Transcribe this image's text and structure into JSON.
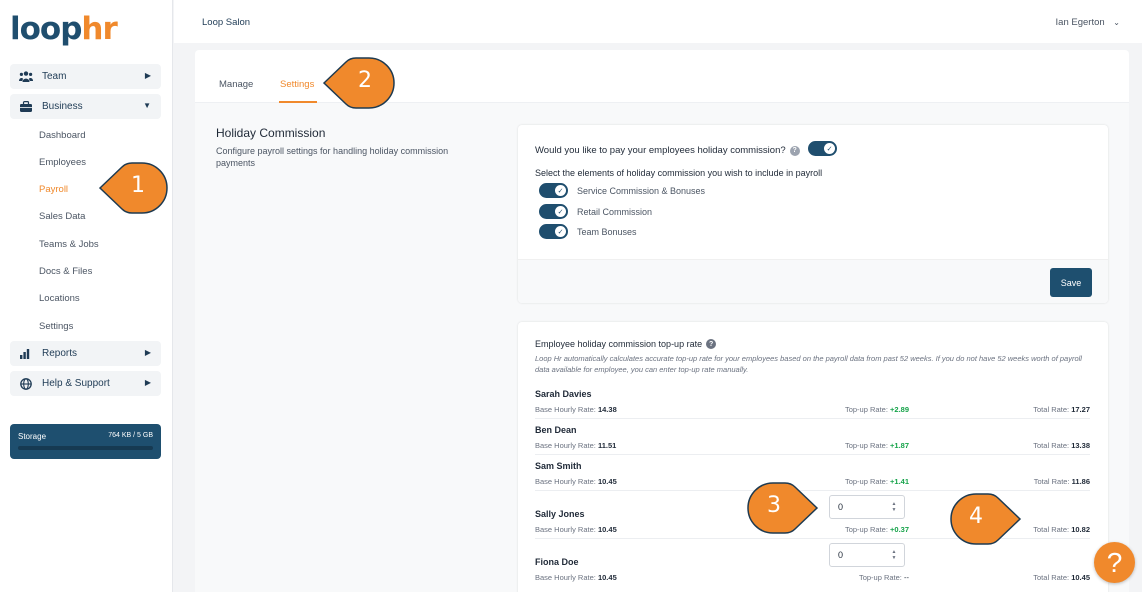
{
  "app": {
    "logo_part1": "loop",
    "logo_part2": "hr"
  },
  "header": {
    "salon": "Loop Salon",
    "user": "Ian Egerton"
  },
  "sidebar": {
    "groups": {
      "team": {
        "label": "Team",
        "icon": "users-icon"
      },
      "business": {
        "label": "Business",
        "icon": "briefcase-icon"
      },
      "reports": {
        "label": "Reports",
        "icon": "bar-chart-icon"
      },
      "help": {
        "label": "Help & Support",
        "icon": "globe-icon"
      }
    },
    "business_items": {
      "dashboard": "Dashboard",
      "employees": "Employees",
      "payroll": "Payroll",
      "sales_data": "Sales Data",
      "teams_jobs": "Teams & Jobs",
      "docs_files": "Docs & Files",
      "locations": "Locations",
      "settings": "Settings"
    },
    "storage": {
      "label": "Storage",
      "value": "764 KB / 5 GB",
      "used_fraction": 0.0
    }
  },
  "tabs": {
    "manage": "Manage",
    "settings": "Settings"
  },
  "section": {
    "title": "Holiday Commission",
    "description": "Configure payroll settings for handling holiday commission payments"
  },
  "commission_panel": {
    "question": "Would you like to pay your employees holiday commission?",
    "question_enabled": true,
    "select_text": "Select the elements of holiday commission you wish to include in payroll",
    "options": {
      "service": {
        "label": "Service Commission & Bonuses",
        "enabled": true
      },
      "retail": {
        "label": "Retail Commission",
        "enabled": true
      },
      "team": {
        "label": "Team Bonuses",
        "enabled": true
      }
    },
    "save_label": "Save"
  },
  "topup_panel": {
    "title": "Employee holiday commission top-up rate",
    "description": "Loop Hr automatically calculates accurate top-up rate for your employees based on the payroll data from past 52 weeks. If you do not have 52 weeks worth of payroll data available for employee, you can enter top-up rate manually.",
    "base_label": "Base Hourly Rate:",
    "topup_label": "Top-up Rate:",
    "total_label": "Total Rate:",
    "employees": {
      "e0": {
        "name": "Sarah Davies",
        "base": "14.38",
        "topup": "+2.89",
        "total": "17.27"
      },
      "e1": {
        "name": "Ben Dean",
        "base": "11.51",
        "topup": "+1.87",
        "total": "13.38"
      },
      "e2": {
        "name": "Sam Smith",
        "base": "10.45",
        "topup": "+1.41",
        "total": "11.86"
      },
      "e3": {
        "name": "Sally Jones",
        "base": "10.45",
        "topup": "+0.37",
        "total": "10.82",
        "input_value": "0"
      },
      "e4": {
        "name": "Fiona Doe",
        "base": "10.45",
        "topup": "--",
        "total": "10.45",
        "input_value": "0"
      }
    }
  },
  "callouts": {
    "c1": "1",
    "c2": "2",
    "c3": "3",
    "c4": "4"
  },
  "help_fab": {
    "label": "?"
  },
  "colors": {
    "brand_navy": "#1e4f6f",
    "accent_orange": "#f0892c",
    "positive_green": "#16a34a"
  }
}
